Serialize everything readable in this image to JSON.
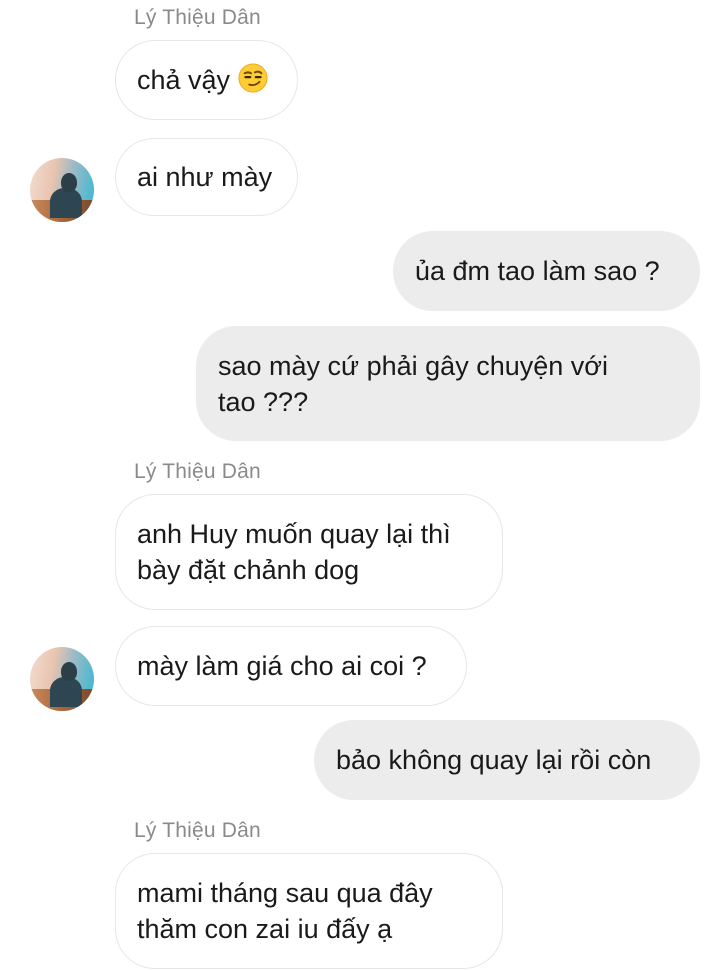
{
  "chat": {
    "messages": [
      {
        "sender": "Lý Thiệu Dân",
        "text": "chả vậy",
        "emoji": "smirking-face"
      },
      {
        "text": "ai như mày"
      },
      {
        "text": "ủa đm tao làm sao ?"
      },
      {
        "text": "sao mày cứ phải gây chuyện với\ntao ???"
      },
      {
        "sender": "Lý Thiệu Dân",
        "text": "anh Huy muốn quay lại thì\nbày đặt chảnh dog"
      },
      {
        "text": "mày làm giá cho ai coi ?"
      },
      {
        "text": "bảo không quay lại rồi còn"
      },
      {
        "sender": "Lý Thiệu Dân",
        "text": "mami tháng sau qua đây\nthăm con zai iu đấy ạ"
      }
    ]
  },
  "colors": {
    "incoming_bubble": "#ffffff",
    "outgoing_bubble": "#ececec",
    "sender_name": "#8a8a8a"
  }
}
